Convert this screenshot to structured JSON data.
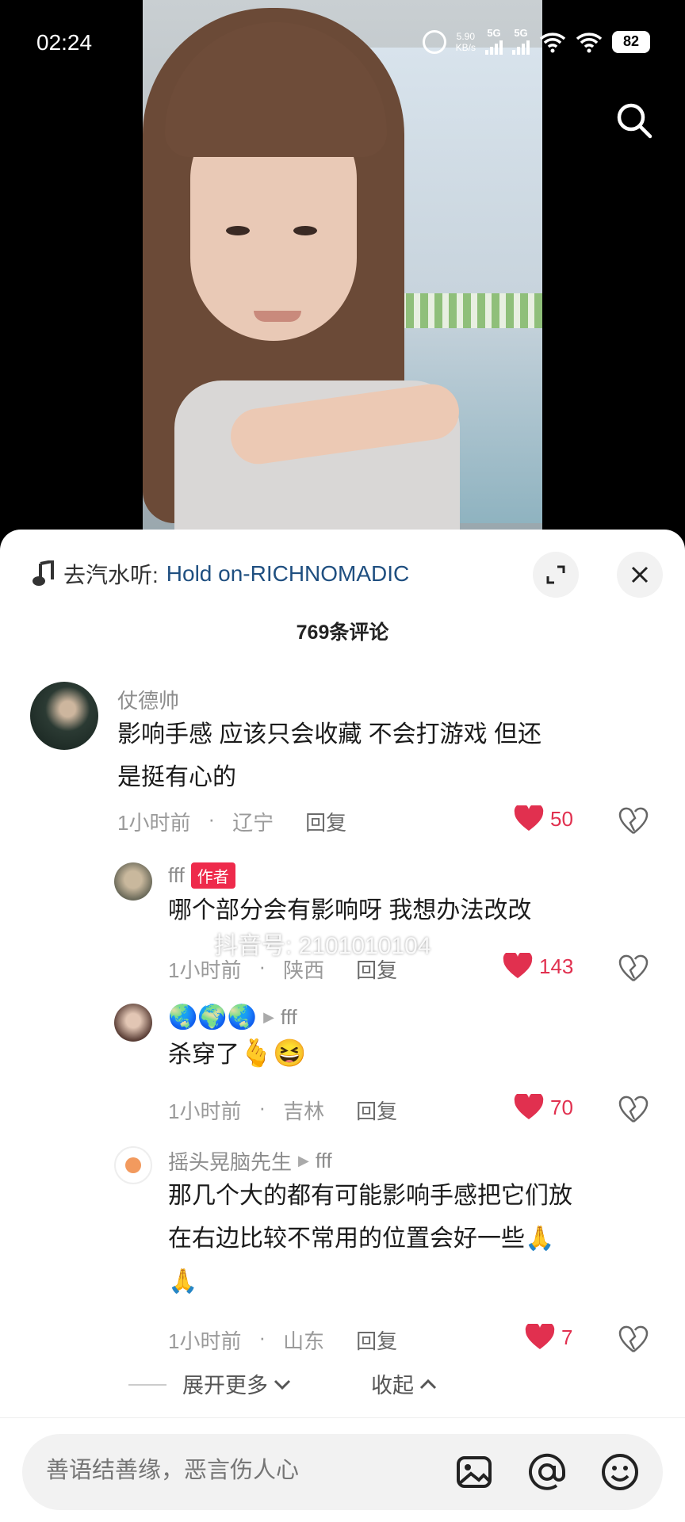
{
  "status_bar": {
    "time": "02:24",
    "net_speed": "5.90",
    "net_unit": "KB/s",
    "sim1": "5G",
    "sim2": "5G",
    "battery": "82"
  },
  "music": {
    "prefix": "去汽水听:",
    "song": "Hold on-RICHNOMADIC"
  },
  "comments_header": {
    "count_label": "769条评论"
  },
  "comments": [
    {
      "user": "仗德帅",
      "text_line1": "影响手感  应该只会收藏  不会打游戏  但还",
      "text_line2": "是挺有心的",
      "time": "1小时前",
      "dot": "·",
      "location": "辽宁",
      "reply": "回复",
      "likes": "50"
    },
    {
      "user": "fff",
      "badge": "作者",
      "text": "哪个部分会有影响呀 我想办法改改",
      "time": "1小时前",
      "dot": "·",
      "location": "陕西",
      "reply": "回复",
      "likes": "143"
    },
    {
      "user_globes": "🌏🌍🌏",
      "reply_to": "fff",
      "text": "杀穿了",
      "emojis": "🫰😆",
      "time": "1小时前",
      "dot": "·",
      "location": "吉林",
      "reply": "回复",
      "likes": "70"
    },
    {
      "user": "摇头晃脑先生",
      "reply_to": "fff",
      "text_line1": "那几个大的都有可能影响手感把它们放",
      "text_line2": "在右边比较不常用的位置会好一些🙏",
      "text_line3": "🙏",
      "time": "1小时前",
      "dot": "·",
      "location": "山东",
      "reply": "回复",
      "likes": "7"
    }
  ],
  "expand": {
    "more": "展开更多",
    "collapse": "收起"
  },
  "input": {
    "placeholder": "善语结善缘，恶言伤人心"
  },
  "watermark": "抖音号: 2101010104",
  "colors": {
    "accent_red": "#e1304f",
    "author_badge": "#ee2a4b",
    "song_blue": "#1f4f80"
  }
}
